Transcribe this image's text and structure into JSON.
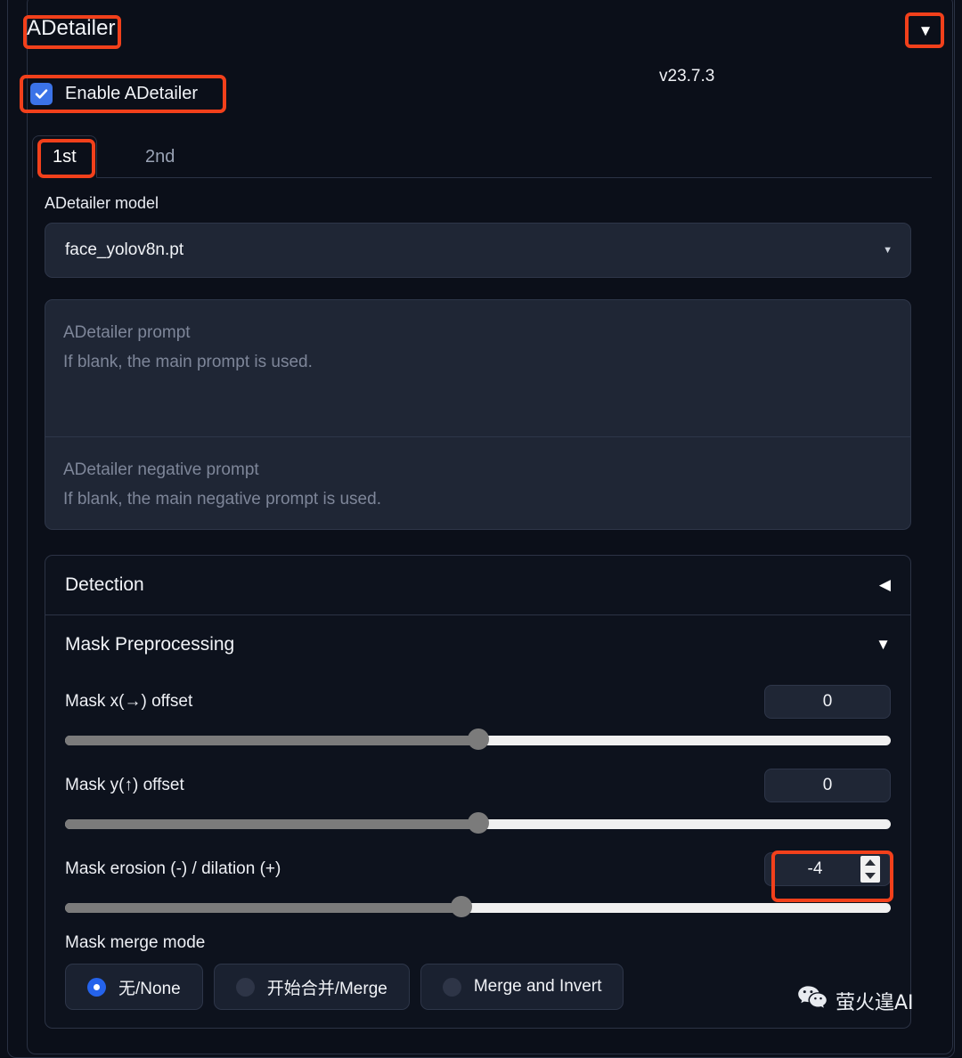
{
  "panel": {
    "title": "ADetailer",
    "version": "v23.7.3",
    "collapse_icon": "triangle-down-icon"
  },
  "enable": {
    "label": "Enable ADetailer",
    "checked": true,
    "checkbox_color": "#3b73e8"
  },
  "tabs": [
    {
      "label": "1st",
      "active": true
    },
    {
      "label": "2nd",
      "active": false
    }
  ],
  "model": {
    "label": "ADetailer model",
    "value": "face_yolov8n.pt",
    "caret_icon": "chevron-down-icon"
  },
  "prompt": {
    "title": "ADetailer prompt",
    "hint": "If blank, the main prompt is used."
  },
  "negative_prompt": {
    "title": "ADetailer negative prompt",
    "hint": "If blank, the main negative prompt is used."
  },
  "accordions": [
    {
      "title": "Detection",
      "arrow": "◀",
      "expanded": false
    },
    {
      "title": "Mask Preprocessing",
      "arrow": "▼",
      "expanded": true
    }
  ],
  "sliders": [
    {
      "label": "Mask x(→) offset",
      "value": "0",
      "fill_percent": 50,
      "has_spinner": false
    },
    {
      "label": "Mask y(↑) offset",
      "value": "0",
      "fill_percent": 50,
      "has_spinner": false
    },
    {
      "label": "Mask erosion (-) / dilation (+)",
      "value": "-4",
      "fill_percent": 48,
      "has_spinner": true
    }
  ],
  "merge_mode": {
    "label": "Mask merge mode",
    "options": [
      {
        "label": "无/None",
        "selected": true
      },
      {
        "label": "开始合并/Merge",
        "selected": false
      },
      {
        "label": "Merge and Invert",
        "selected": false
      }
    ]
  },
  "watermark": {
    "text": "萤火遑AI",
    "icon": "wechat-icon"
  },
  "highlight_color": "#f2401b"
}
